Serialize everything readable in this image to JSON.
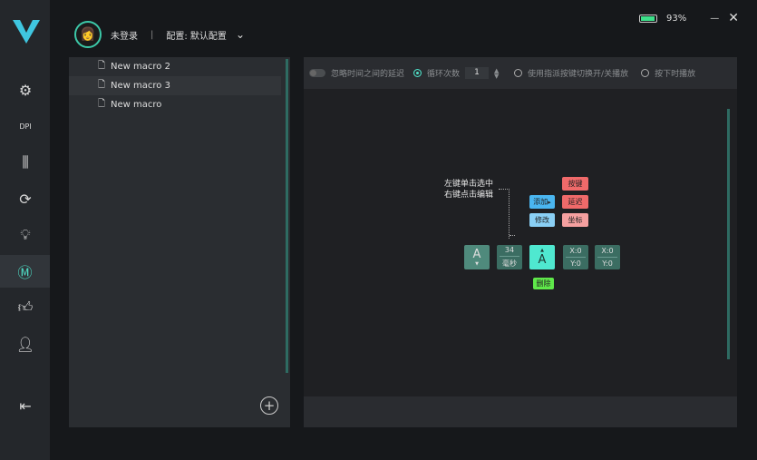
{
  "header": {
    "user": "未登录",
    "separator": "|",
    "config": "配置: 默认配置"
  },
  "status": {
    "battery": "93%",
    "battery_level": 93
  },
  "sidebar": {
    "icons": [
      "device-settings-icon",
      "dpi-icon",
      "equalizer-icon",
      "sync-icon",
      "light-bulb-icon",
      "macro-icon",
      "thumbs-up-icon",
      "user-list-icon"
    ],
    "active": "macro-icon"
  },
  "macros": [
    "New macro 2",
    "New macro 3",
    "New macro"
  ],
  "toolbar": {
    "ignore_delay": "忽略时间之间的延迟",
    "loop": "循环次数",
    "loop_count": "1",
    "toggle_play": "使用指派按键切换开/关播放",
    "press_play": "按下时播放"
  },
  "editor": {
    "tip_line1": "左键单击选中",
    "tip_line2": "右键点击编辑",
    "add": "添加",
    "add_arrow": "▸",
    "modify": "修改",
    "menu": [
      "按键",
      "延迟",
      "坐标"
    ],
    "delete": "删除",
    "blocks": {
      "key1": "A",
      "delay_value": "34",
      "delay_unit": "毫秒",
      "key2": "A",
      "x1": "X:0",
      "y1": "Y:0",
      "x2": "X:0",
      "y2": "Y:0"
    }
  },
  "colors": {
    "accent": "#4fe0c8",
    "menu_red": "#f06a6a",
    "add_blue": "#4ab6f0",
    "delete_green": "#5fe84a"
  }
}
